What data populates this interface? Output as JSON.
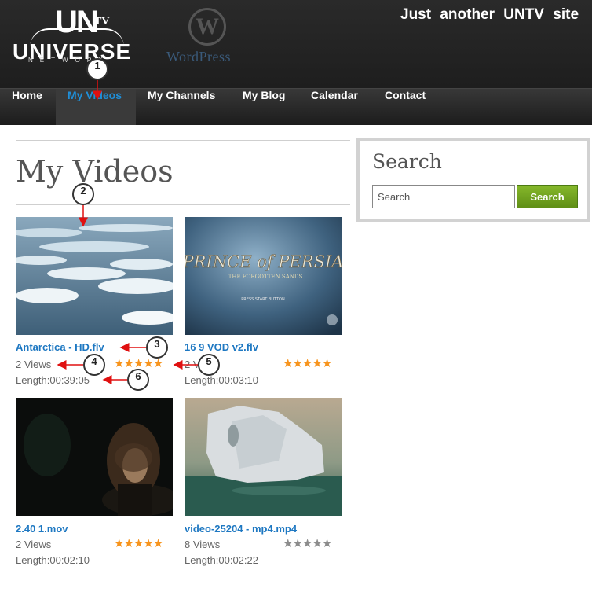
{
  "header": {
    "logo_un": "UN",
    "logo_tv": "TV",
    "logo_universe": "UNIVERSE",
    "logo_network": "NETWORK",
    "wp_mark": "W",
    "wp_text": "WordPress",
    "tagline": "Just another UNTV site"
  },
  "nav": {
    "items": [
      "Home",
      "My Videos",
      "My Channels",
      "My Blog",
      "Calendar",
      "Contact"
    ],
    "active": "My Videos"
  },
  "main": {
    "title": "My Videos",
    "videos": [
      {
        "title": "Antarctica - HD.flv",
        "views": "2 Views",
        "length": "Length:00:39:05",
        "rating": 5
      },
      {
        "title": "16 9 VOD v2.flv",
        "views": "2 Views",
        "length": "Length:00:03:10",
        "rating": 5
      },
      {
        "title": "2.40 1.mov",
        "views": "2 Views",
        "length": "Length:00:02:10",
        "rating": 5
      },
      {
        "title": "video-25204 - mp4.mp4",
        "views": "8 Views",
        "length": "Length:00:02:22",
        "rating": 0
      }
    ],
    "thumb2_text": "PRINCE of PERSIA",
    "thumb2_sub": "THE FORGOTTEN SANDS",
    "thumb2_press": "PRESS START BUTTON"
  },
  "sidebar": {
    "search_title": "Search",
    "search_placeholder": "Search",
    "search_button": "Search"
  },
  "callouts": [
    "1",
    "2",
    "3",
    "4",
    "5",
    "6"
  ],
  "colors": {
    "link": "#1e78c2",
    "nav_active": "#1f8fd8",
    "star_on": "#f7941d",
    "star_off": "#8c8c8c",
    "button": "#6fa01e"
  }
}
